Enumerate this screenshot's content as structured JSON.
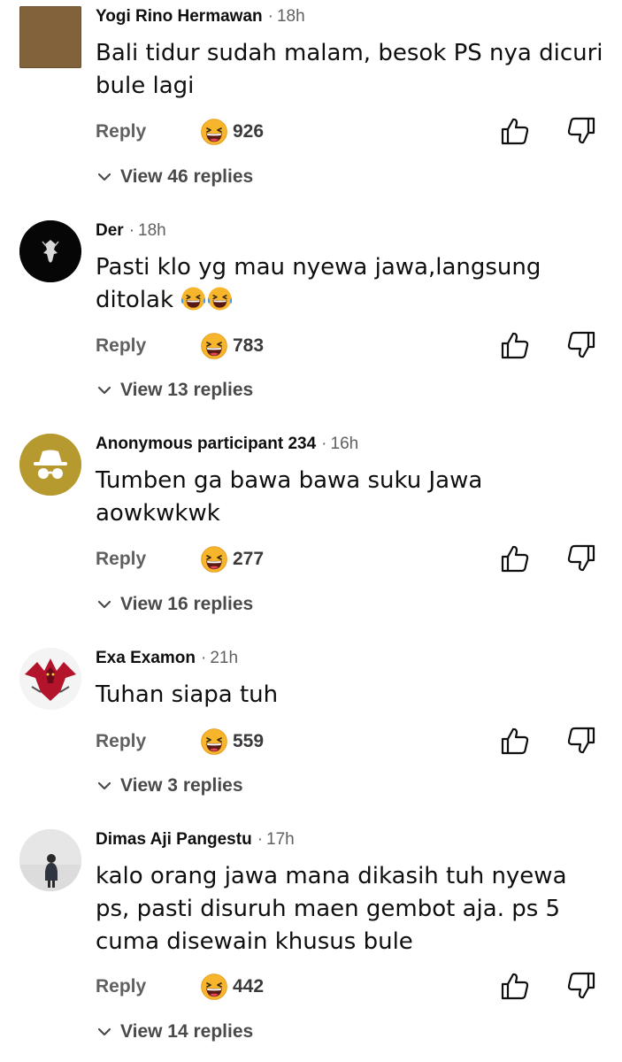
{
  "colors": {
    "text_primary": "#0f0f0f",
    "text_secondary": "#606060",
    "emoji_face": "#f5a623",
    "background": "#ffffff"
  },
  "actions": {
    "reply_label": "Reply"
  },
  "icons": {
    "reaction": "grinning-squinting-face-icon",
    "like": "thumbs-up-outline-icon",
    "dislike": "thumbs-down-outline-icon",
    "expand": "chevron-down-icon"
  },
  "comments": [
    {
      "author": "Yogi Rino Hermawan",
      "separator": "·",
      "time": "18h",
      "text": "Bali tidur sudah malam, besok PS nya dicuri bule lagi",
      "reaction_count": "926",
      "view_replies": "View 46 replies"
    },
    {
      "author": "Der",
      "separator": "·",
      "time": "18h",
      "text": "Pasti klo yg mau nyewa jawa,langsung ditolak",
      "text_emoji": "😂😂",
      "reaction_count": "783",
      "view_replies": "View 13 replies"
    },
    {
      "author": "Anonymous participant 234",
      "separator": "·",
      "time": "16h",
      "text": "Tumben ga bawa bawa suku Jawa aowkwkwk",
      "reaction_count": "277",
      "view_replies": "View 16 replies"
    },
    {
      "author": "Exa Examon",
      "separator": "·",
      "time": "21h",
      "text": "Tuhan siapa tuh",
      "reaction_count": "559",
      "view_replies": "View 3 replies"
    },
    {
      "author": "Dimas Aji Pangestu",
      "separator": "·",
      "time": "17h",
      "text": "kalo orang jawa mana dikasih tuh nyewa ps, pasti disuruh maen gembot aja. ps 5 cuma disewain khusus bule",
      "reaction_count": "442",
      "view_replies": "View 14 replies"
    }
  ]
}
